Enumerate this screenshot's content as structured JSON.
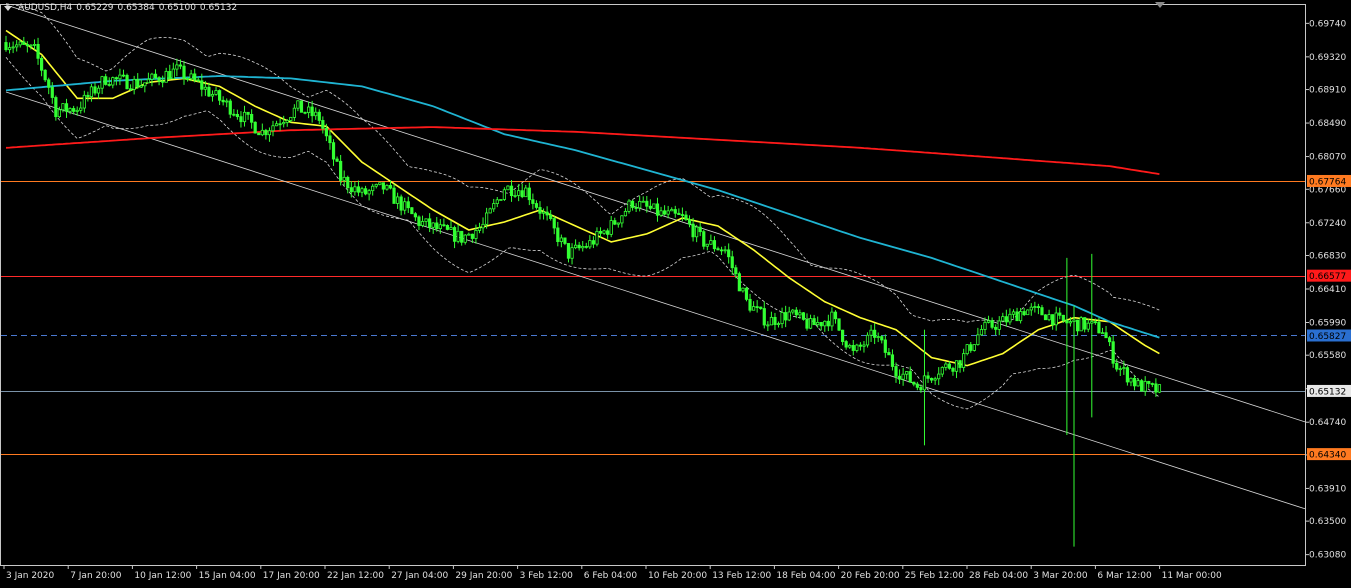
{
  "header": {
    "symbol": "AUDUSD,H4",
    "open": "0.65229",
    "high": "0.65384",
    "low": "0.65100",
    "close": "0.65132",
    "menu_icon": "triangle-down-icon"
  },
  "colors": {
    "background": "#000000",
    "frame": "#c8c8c8",
    "candle": "#33ff33",
    "ma_short": "#ffff33",
    "ma_mid": "#1fb4d2",
    "ma_long": "#ff1a1a",
    "envelope": "#d8d8d8",
    "channel": "#d8d8d8",
    "level_orange": "#ff7a20",
    "level_red": "#ff2a2a",
    "level_blue": "#4a78d0",
    "level_grey": "#7a92a8"
  },
  "chart_data": {
    "type": "candlestick",
    "symbol": "AUDUSD",
    "timeframe": "H4",
    "ylim": [
      0.6295,
      0.6997
    ],
    "y_ticks": [
      "0.69740",
      "0.69320",
      "0.68910",
      "0.68490",
      "0.68070",
      "0.67660",
      "0.67240",
      "0.66830",
      "0.66410",
      "0.65990",
      "0.65580",
      "0.65160",
      "0.64740",
      "0.64330",
      "0.63910",
      "0.63500",
      "0.63080"
    ],
    "x_ticks": [
      "3 Jan 2020",
      "7 Jan 20:00",
      "10 Jan 12:00",
      "15 Jan 04:00",
      "17 Jan 20:00",
      "22 Jan 12:00",
      "27 Jan 04:00",
      "29 Jan 20:00",
      "3 Feb 12:00",
      "6 Feb 04:00",
      "10 Feb 20:00",
      "13 Feb 12:00",
      "18 Feb 04:00",
      "20 Feb 20:00",
      "25 Feb 12:00",
      "28 Feb 04:00",
      "3 Mar 20:00",
      "6 Mar 12:00",
      "11 Mar 00:00"
    ],
    "price_anchors": [
      [
        0,
        0.695
      ],
      [
        8,
        0.694
      ],
      [
        12,
        0.6895
      ],
      [
        14,
        0.6865
      ],
      [
        20,
        0.6868
      ],
      [
        28,
        0.6905
      ],
      [
        38,
        0.6898
      ],
      [
        48,
        0.6915
      ],
      [
        54,
        0.6898
      ],
      [
        62,
        0.6872
      ],
      [
        72,
        0.6838
      ],
      [
        82,
        0.6868
      ],
      [
        88,
        0.6855
      ],
      [
        94,
        0.678
      ],
      [
        100,
        0.676
      ],
      [
        106,
        0.6768
      ],
      [
        116,
        0.6725
      ],
      [
        128,
        0.6705
      ],
      [
        134,
        0.672
      ],
      [
        140,
        0.6768
      ],
      [
        146,
        0.6765
      ],
      [
        152,
        0.6728
      ],
      [
        158,
        0.6685
      ],
      [
        164,
        0.6698
      ],
      [
        170,
        0.672
      ],
      [
        176,
        0.675
      ],
      [
        184,
        0.6735
      ],
      [
        190,
        0.673
      ],
      [
        196,
        0.67
      ],
      [
        202,
        0.669
      ],
      [
        208,
        0.6625
      ],
      [
        214,
        0.66
      ],
      [
        220,
        0.661
      ],
      [
        226,
        0.6595
      ],
      [
        232,
        0.6605
      ],
      [
        238,
        0.656
      ],
      [
        244,
        0.6585
      ],
      [
        250,
        0.654
      ],
      [
        256,
        0.652
      ],
      [
        262,
        0.654
      ],
      [
        268,
        0.655
      ],
      [
        274,
        0.659
      ],
      [
        280,
        0.66
      ],
      [
        286,
        0.6615
      ],
      [
        292,
        0.661
      ],
      [
        296,
        0.66
      ],
      [
        300,
        0.6598
      ],
      [
        304,
        0.6595
      ],
      [
        308,
        0.659
      ],
      [
        312,
        0.6545
      ],
      [
        318,
        0.652
      ],
      [
        324,
        0.6513
      ]
    ],
    "spikes": [
      [
        258,
        0.6445,
        0.659
      ],
      [
        298,
        0.6458,
        0.668
      ],
      [
        300,
        0.6318,
        0.662
      ],
      [
        305,
        0.648,
        0.6685
      ]
    ],
    "bars": 325,
    "moving_averages": [
      {
        "period": "short",
        "color_key": "ma_short",
        "anchors": [
          [
            0,
            0.6965
          ],
          [
            10,
            0.6935
          ],
          [
            20,
            0.688
          ],
          [
            30,
            0.688
          ],
          [
            40,
            0.69
          ],
          [
            50,
            0.6905
          ],
          [
            60,
            0.6895
          ],
          [
            70,
            0.687
          ],
          [
            80,
            0.685
          ],
          [
            90,
            0.6845
          ],
          [
            100,
            0.68
          ],
          [
            110,
            0.677
          ],
          [
            120,
            0.674
          ],
          [
            130,
            0.6715
          ],
          [
            140,
            0.6725
          ],
          [
            150,
            0.674
          ],
          [
            160,
            0.672
          ],
          [
            170,
            0.67
          ],
          [
            180,
            0.671
          ],
          [
            190,
            0.673
          ],
          [
            200,
            0.672
          ],
          [
            210,
            0.669
          ],
          [
            220,
            0.6655
          ],
          [
            230,
            0.6625
          ],
          [
            240,
            0.6605
          ],
          [
            250,
            0.659
          ],
          [
            260,
            0.6555
          ],
          [
            270,
            0.6545
          ],
          [
            280,
            0.656
          ],
          [
            290,
            0.659
          ],
          [
            300,
            0.6605
          ],
          [
            310,
            0.66
          ],
          [
            320,
            0.657
          ],
          [
            324,
            0.656
          ]
        ]
      },
      {
        "period": "mid",
        "color_key": "ma_mid",
        "anchors": [
          [
            0,
            0.689
          ],
          [
            30,
            0.6902
          ],
          [
            60,
            0.6908
          ],
          [
            80,
            0.6905
          ],
          [
            100,
            0.6895
          ],
          [
            120,
            0.687
          ],
          [
            140,
            0.6835
          ],
          [
            160,
            0.6815
          ],
          [
            180,
            0.679
          ],
          [
            200,
            0.6765
          ],
          [
            220,
            0.6735
          ],
          [
            240,
            0.6705
          ],
          [
            260,
            0.668
          ],
          [
            280,
            0.665
          ],
          [
            300,
            0.662
          ],
          [
            310,
            0.66
          ],
          [
            324,
            0.658
          ]
        ]
      },
      {
        "period": "long",
        "color_key": "ma_long",
        "anchors": [
          [
            0,
            0.6818
          ],
          [
            40,
            0.683
          ],
          [
            80,
            0.684
          ],
          [
            120,
            0.6844
          ],
          [
            160,
            0.6838
          ],
          [
            200,
            0.6828
          ],
          [
            240,
            0.6818
          ],
          [
            280,
            0.6805
          ],
          [
            310,
            0.6795
          ],
          [
            324,
            0.6785
          ]
        ]
      }
    ],
    "channel_lines": [
      {
        "from": [
          0,
          0.6997
        ],
        "to": [
          324,
          0.6533
        ]
      },
      {
        "from": [
          0,
          0.6888
        ],
        "to": [
          324,
          0.6424
        ]
      }
    ],
    "horizontal_levels": [
      {
        "price": "0.67764",
        "value": 0.67764,
        "style": "solid",
        "color_key": "level_orange",
        "label_bg": "#ff7a20"
      },
      {
        "price": "0.66577",
        "value": 0.66577,
        "style": "solid",
        "color_key": "level_red",
        "label_bg": "#ff1a1a"
      },
      {
        "price": "0.65827",
        "value": 0.65827,
        "style": "dashed",
        "color_key": "level_blue",
        "label_bg": "#2a6fd0"
      },
      {
        "price": "0.65132",
        "value": 0.65132,
        "style": "solid",
        "color_key": "level_grey",
        "label_bg": "#e8e8e8"
      },
      {
        "price": "0.64340",
        "value": 0.6434,
        "style": "solid",
        "color_key": "level_orange",
        "label_bg": "#ff7a20"
      }
    ],
    "envelope_offset": 0.0042,
    "grid": false
  }
}
